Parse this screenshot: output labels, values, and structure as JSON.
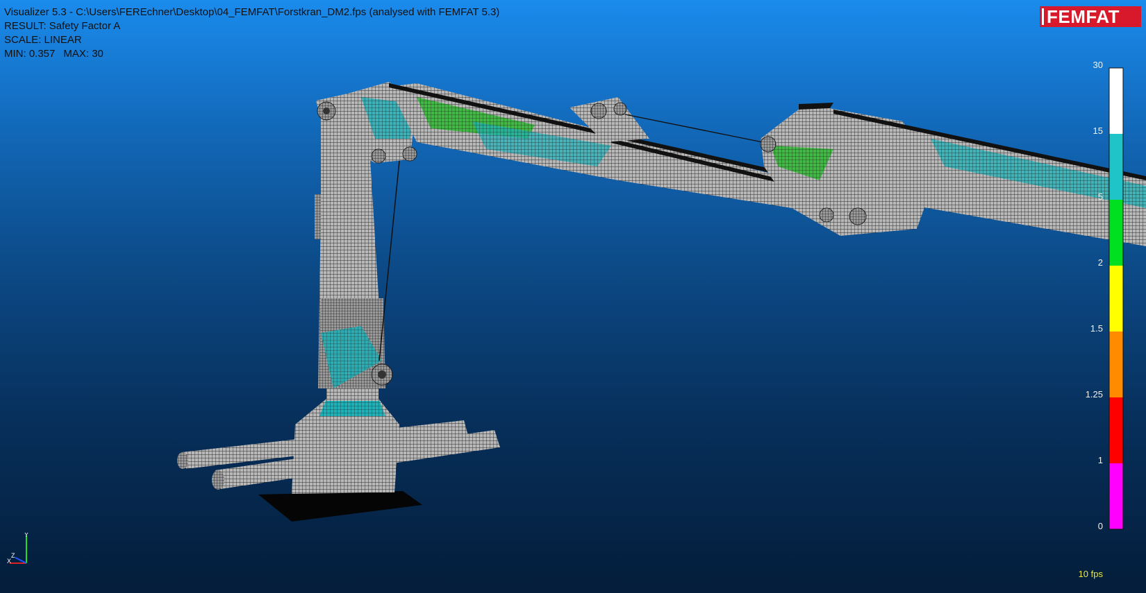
{
  "header": {
    "title": "Visualizer 5.3 - C:\\Users\\FEREchner\\Desktop\\04_FEMFAT\\Forstkran_DM2.fps (analysed with FEMFAT 5.3)",
    "result": "RESULT: Safety Factor A",
    "scale": "SCALE: LINEAR",
    "min": "MIN: 0.357",
    "max": "MAX: 30"
  },
  "logo": {
    "text": "FEMFAT",
    "color": "#d8192b"
  },
  "legend": {
    "labels": [
      "30",
      "15",
      "5",
      "2",
      "1.5",
      "1.25",
      "1",
      "0"
    ],
    "colors": [
      "#ffffff",
      "#1fc4c8",
      "#00e020",
      "#ffff00",
      "#ff8c00",
      "#ff0000",
      "#ff00ff"
    ]
  },
  "status": {
    "fps": "10 fps"
  },
  "triad": {
    "x_label": "X",
    "y_label": "Y",
    "z_label": "Z"
  },
  "colors": {
    "background_top": "#1a8bec",
    "background_bottom": "#041d3a",
    "mesh_gray": "#b0b0b0",
    "mesh_cyan": "#1fc4c8",
    "mesh_green": "#2fbf3a"
  }
}
